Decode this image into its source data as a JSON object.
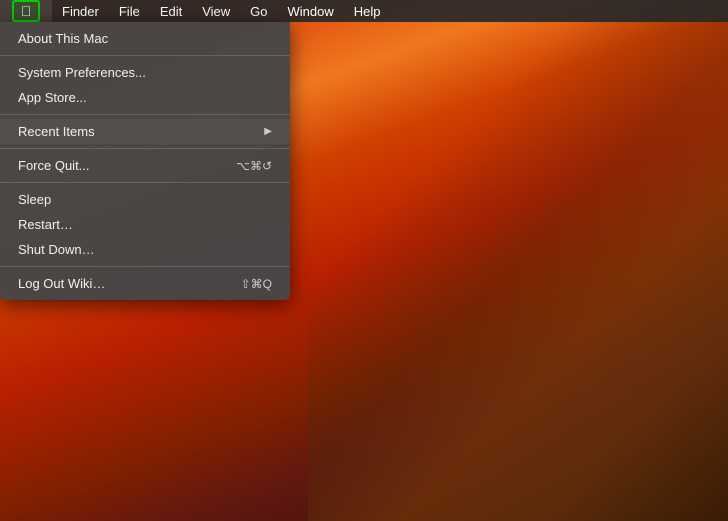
{
  "desktop": {
    "background_description": "macOS Yosemite warm orange sunset desktop"
  },
  "menu_bar": {
    "items": [
      {
        "id": "apple",
        "label": "Apple Menu",
        "symbol": ""
      },
      {
        "id": "finder",
        "label": "Finder"
      },
      {
        "id": "file",
        "label": "File"
      },
      {
        "id": "edit",
        "label": "Edit"
      },
      {
        "id": "view",
        "label": "View"
      },
      {
        "id": "go",
        "label": "Go"
      },
      {
        "id": "window",
        "label": "Window"
      },
      {
        "id": "help",
        "label": "Help"
      }
    ]
  },
  "apple_dropdown": {
    "items": [
      {
        "id": "about",
        "label": "About This Mac",
        "shortcut": "",
        "has_arrow": false,
        "separator_after": false
      },
      {
        "id": "sep1",
        "type": "separator"
      },
      {
        "id": "system_prefs",
        "label": "System Preferences...",
        "shortcut": "",
        "has_arrow": false,
        "separator_after": false
      },
      {
        "id": "app_store",
        "label": "App Store...",
        "shortcut": "",
        "has_arrow": false,
        "separator_after": false
      },
      {
        "id": "sep2",
        "type": "separator"
      },
      {
        "id": "recent_items",
        "label": "Recent Items",
        "shortcut": "",
        "has_arrow": true,
        "separator_after": false,
        "highlighted": true
      },
      {
        "id": "sep3",
        "type": "separator"
      },
      {
        "id": "force_quit",
        "label": "Force Quit...",
        "shortcut": "⌥⌘↺",
        "has_arrow": false,
        "separator_after": false
      },
      {
        "id": "sep4",
        "type": "separator"
      },
      {
        "id": "sleep",
        "label": "Sleep",
        "shortcut": "",
        "has_arrow": false,
        "separator_after": false
      },
      {
        "id": "restart",
        "label": "Restart…",
        "shortcut": "",
        "has_arrow": false,
        "separator_after": false
      },
      {
        "id": "shutdown",
        "label": "Shut Down…",
        "shortcut": "",
        "has_arrow": false,
        "separator_after": false
      },
      {
        "id": "sep5",
        "type": "separator"
      },
      {
        "id": "logout",
        "label": "Log Out Wiki…",
        "shortcut": "⇧⌘Q",
        "has_arrow": false,
        "separator_after": false
      }
    ],
    "arrow_symbol": "▶",
    "separator_type": "separator"
  }
}
